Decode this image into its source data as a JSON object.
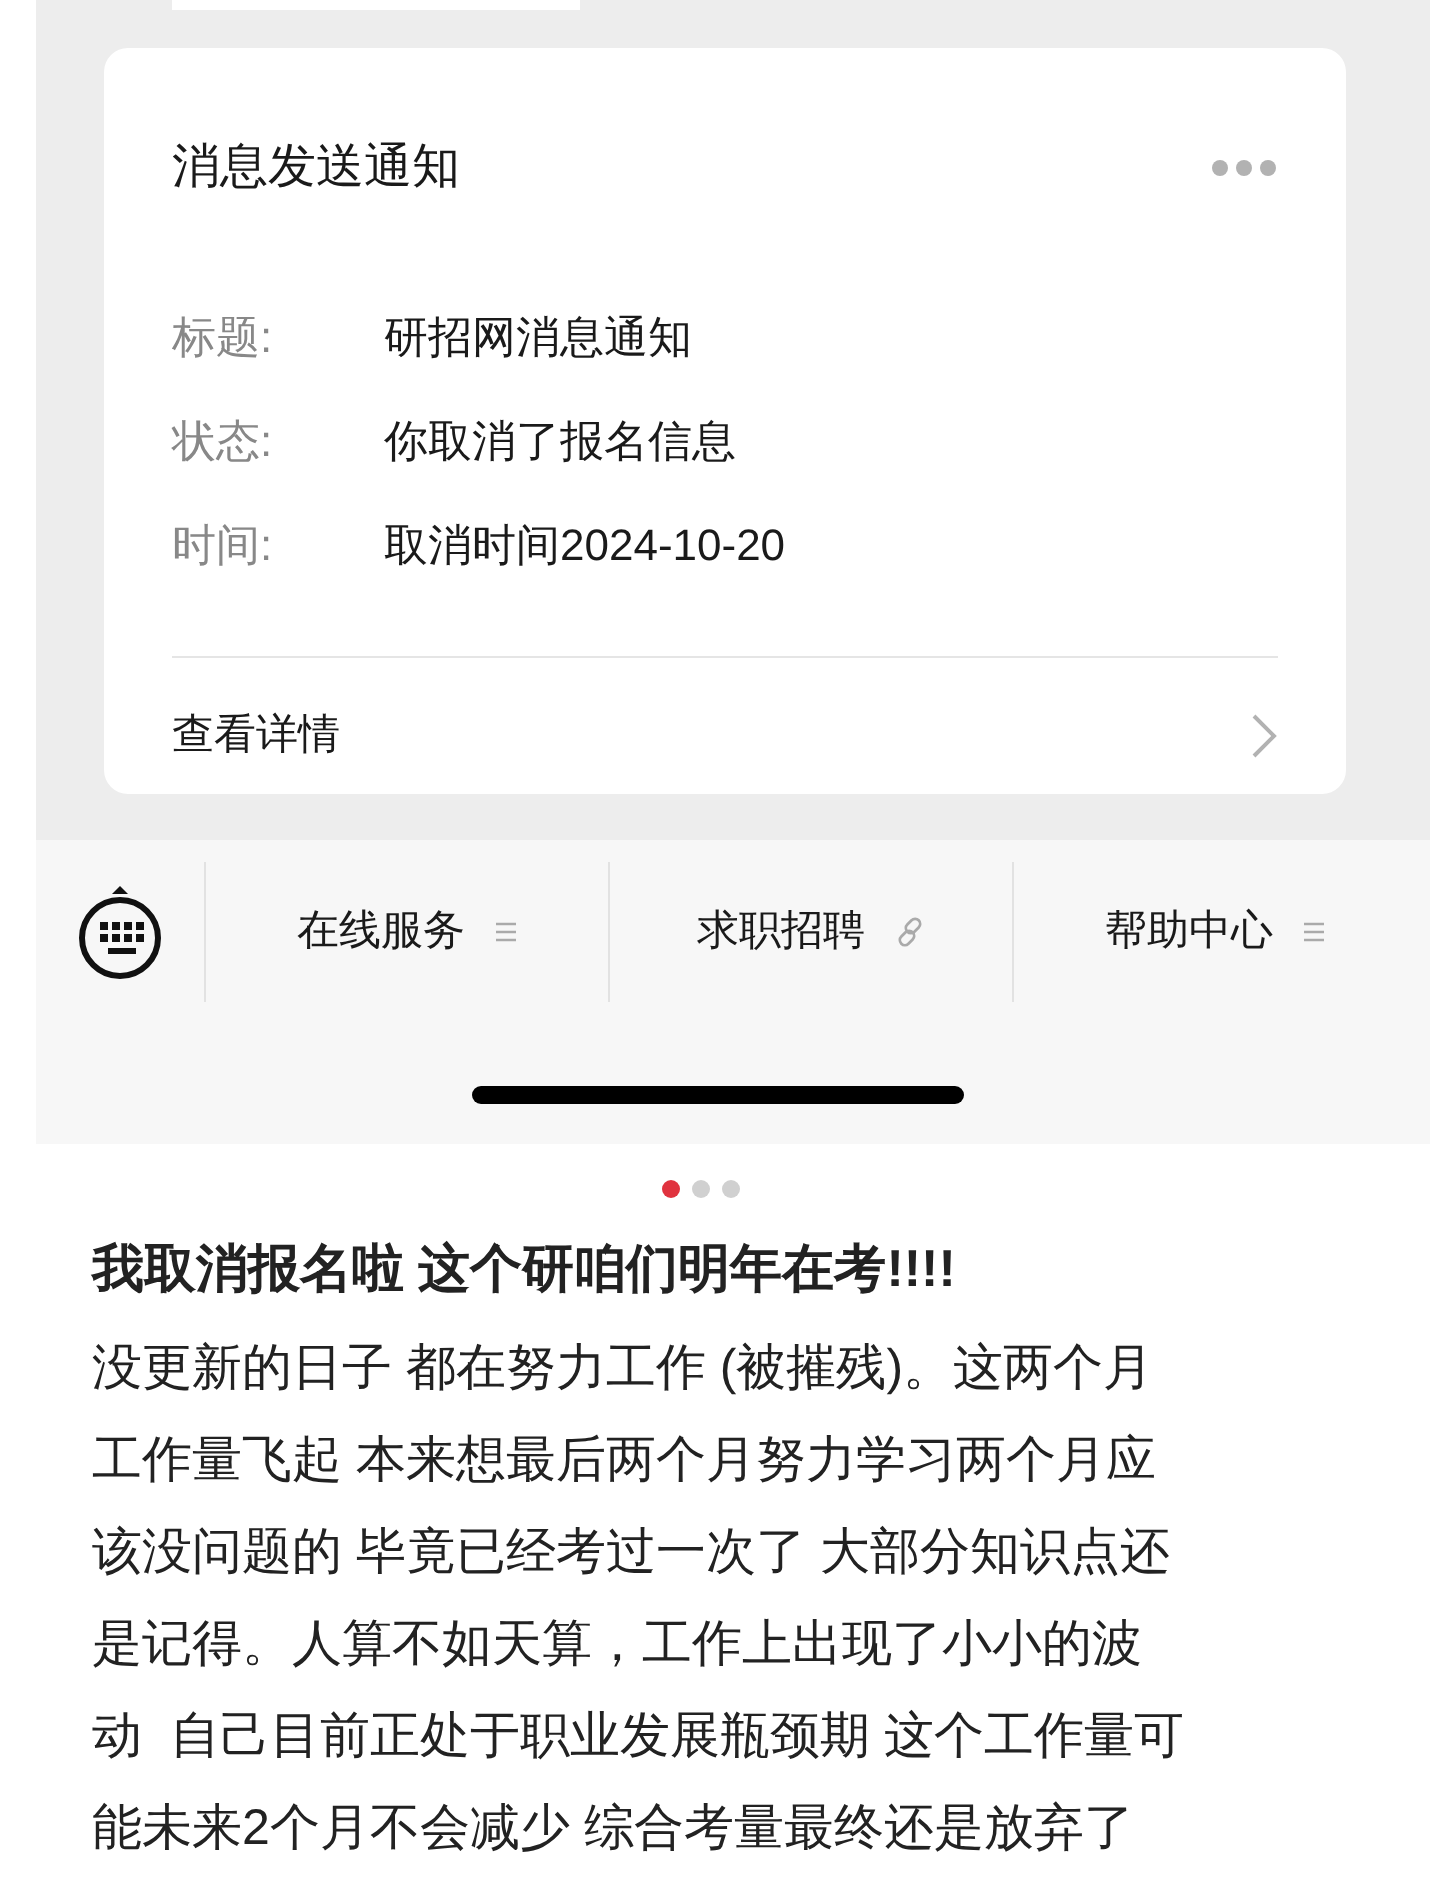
{
  "card": {
    "title": "消息发送通知",
    "fields": [
      {
        "label": "标题:",
        "value": "研招网消息通知"
      },
      {
        "label": "状态:",
        "value": "你取消了报名信息"
      },
      {
        "label": "时间:",
        "value": "取消时间2024-10-20"
      }
    ],
    "link": "查看详情"
  },
  "menu": [
    {
      "label": "在线服务",
      "kind": "list"
    },
    {
      "label": "求职招聘",
      "kind": "link"
    },
    {
      "label": "帮助中心",
      "kind": "list"
    }
  ],
  "pager": [
    {
      "selected": true
    },
    {
      "selected": false
    },
    {
      "selected": false
    }
  ],
  "post": {
    "title": "我取消报名啦 这个研咱们明年在考!!!!",
    "body": [
      "没更新的日子 都在努力工作 (被摧残)。这两个月",
      "工作量飞起 本来想最后两个月努力学习两个月应",
      "该没问题的 毕竟已经考过一次了 大部分知识点还",
      "是记得。人算不如天算，工作上出现了小小的波",
      "动  自己目前正处于职业发展瓶颈期 这个工作量可",
      "能未来2个月不会减少 综合考量最终还是放弃了"
    ]
  }
}
